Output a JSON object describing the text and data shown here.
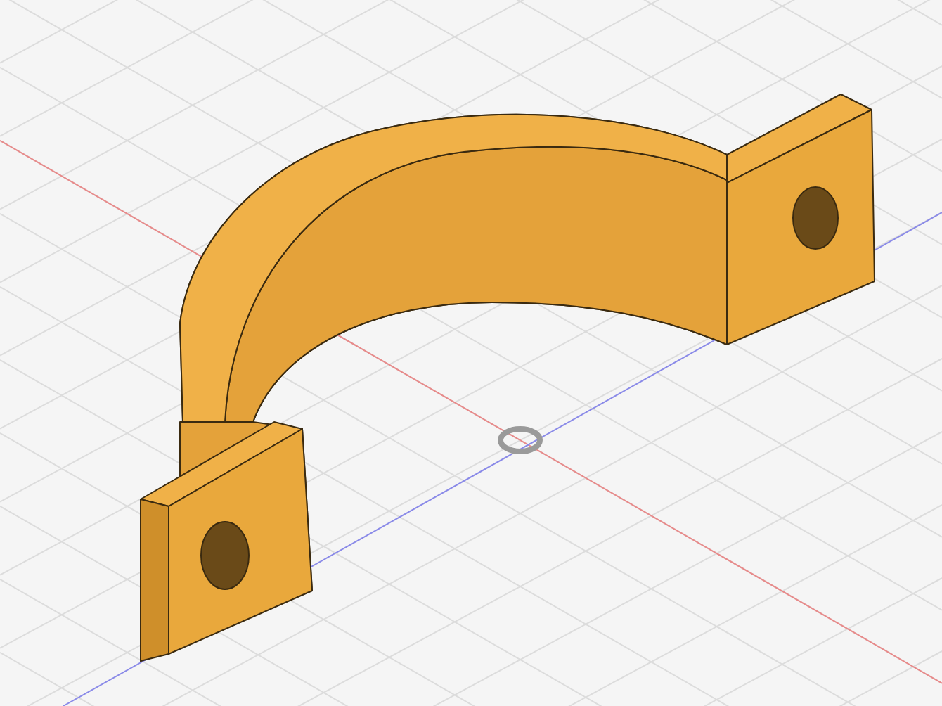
{
  "viewport": {
    "grid": true,
    "axes": true,
    "origin_marker": true
  }
}
